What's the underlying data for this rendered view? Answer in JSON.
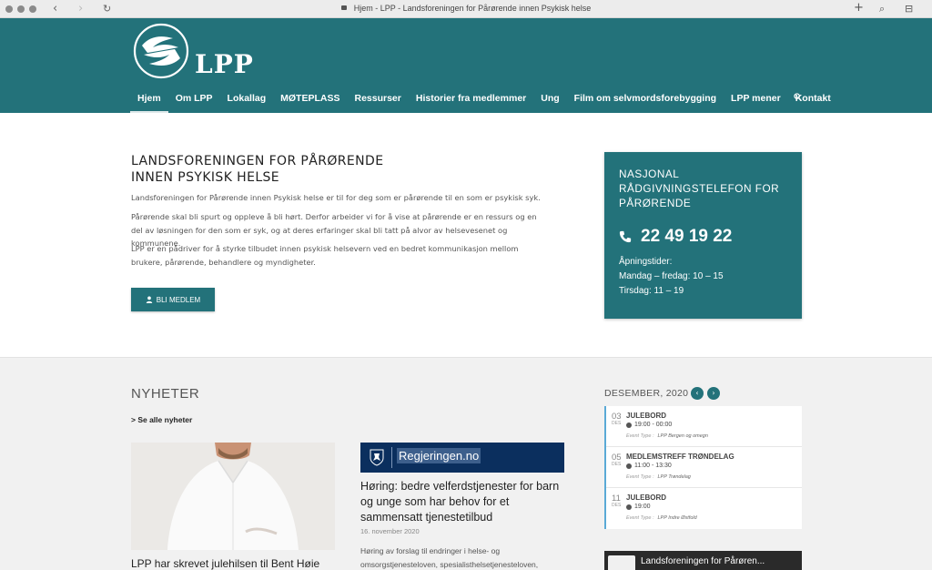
{
  "browser": {
    "tab_title": "Hjem - LPP - Landsforeningen for Pårørende innen Psykisk helse",
    "back": "‹",
    "forward": "›",
    "reload": "↻",
    "new_tab": "+",
    "search_symbol": "⌕",
    "sidebar_symbol": "⊟"
  },
  "logo": {
    "text": "LPP"
  },
  "nav": {
    "items": [
      "Hjem",
      "Om LPP",
      "Lokallag",
      "MØTEPLASS",
      "Ressurser",
      "Historier fra medlemmer",
      "Ung",
      "Film om selvmordsforebygging",
      "LPP mener",
      "Kontakt"
    ],
    "active": "Hjem"
  },
  "intro": {
    "title_line1": "LANDSFORENINGEN FOR PÅRØRENDE",
    "title_line2": "INNEN PSYKISK HELSE",
    "p1": "Landsforeningen for Pårørende innen Psykisk helse er til for deg som er pårørende til en som er psykisk syk.",
    "p2": "Pårørende skal bli spurt og oppleve å bli hørt. Derfor arbeider vi for å vise at pårørende er en ressurs og en del av løsningen for den som er syk, og at deres erfaringer skal bli tatt på alvor av helsevesenet og kommunene.",
    "p3": "LPP er en pådriver for å styrke tilbudet innen psykisk helsevern ved en bedret kommunikasjon mellom brukere, pårørende, behandlere og myndigheter.",
    "member_button": "BLI MEDLEM"
  },
  "helpline": {
    "title": "NASJONAL RÅDGIVNINGSTELEFON FOR PÅRØRENDE",
    "phone": "22 49 19 22",
    "hours_label": "Åpningstider:",
    "hours_weekday": "Mandag – fredag: 10 – 15",
    "hours_tuesday": "Tirsdag: 11 – 19"
  },
  "news": {
    "title": "NYHETER",
    "see_all": "> Se alle nyheter",
    "article1": {
      "title": "LPP har skrevet julehilsen til Bent Høie"
    },
    "article2": {
      "banner": "Regjeringen.no",
      "title": "Høring: bedre velferdstjenester for barn og unge som har behov for et sammensatt tjenestetilbud",
      "date": "16. november 2020",
      "excerpt": "Høring av forslag til endringer i helse- og omsorgstjenesteloven, spesialisthelsetjenesteloven,"
    }
  },
  "calendar": {
    "month": "DESEMBER, 2020",
    "prev": "‹",
    "next": "›",
    "events": [
      {
        "day": "03",
        "mon": "DES",
        "name": "JULEBORD",
        "time": "19:00 - 00:00",
        "type_label": "Event Type :",
        "type": "LPP Bergen og omegn"
      },
      {
        "day": "05",
        "mon": "DES",
        "name": "MEDLEMSTREFF TRØNDELAG",
        "time": "11:00 - 13:30",
        "type_label": "Event Type :",
        "type": "LPP Trøndelag"
      },
      {
        "day": "11",
        "mon": "DES",
        "name": "JULEBORD",
        "time": "19:00",
        "type_label": "Event Type :",
        "type": "LPP Indre Østfold"
      }
    ]
  },
  "video": {
    "title": "Landsforeningen for Pårøren..."
  },
  "colors": {
    "brand": "#23727a",
    "calendar_accent": "#5aaad6",
    "regjeringen": "#0b2f5e"
  }
}
